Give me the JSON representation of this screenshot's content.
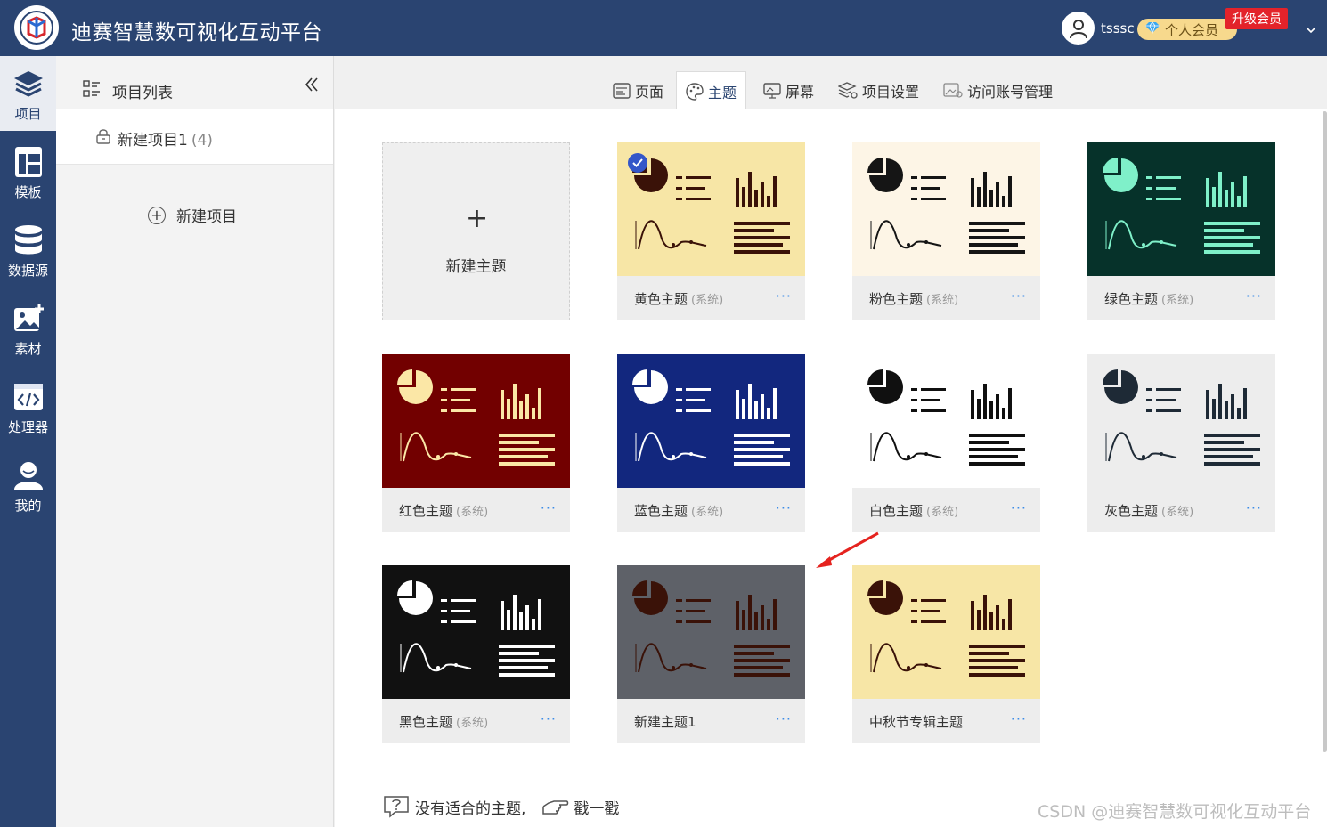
{
  "header": {
    "app_title": "迪赛智慧数可视化互动平台",
    "username": "tsssc",
    "member_label": "个人会员",
    "upgrade_label": "升级会员"
  },
  "nav": [
    {
      "label": "项目",
      "icon": "layers-icon"
    },
    {
      "label": "模板",
      "icon": "template-icon"
    },
    {
      "label": "数据源",
      "icon": "database-icon"
    },
    {
      "label": "素材",
      "icon": "image-add-icon"
    },
    {
      "label": "处理器",
      "icon": "code-icon"
    },
    {
      "label": "我的",
      "icon": "user-icon"
    }
  ],
  "projects": {
    "title": "项目列表",
    "item_name": "新建项目1",
    "item_count": "(4)",
    "new_label": "新建项目"
  },
  "tabs": [
    "页面",
    "主题",
    "屏幕",
    "项目设置",
    "访问账号管理"
  ],
  "new_theme_label": "新建主题",
  "themes": [
    {
      "name": "黄色主题",
      "tag": "(系统)",
      "bg": "#f7e6a6",
      "fg": "#3a1208",
      "selected": true
    },
    {
      "name": "粉色主题",
      "tag": "(系统)",
      "bg": "#fdf5e6",
      "fg": "#151515"
    },
    {
      "name": "绿色主题",
      "tag": "(系统)",
      "bg": "#06322a",
      "fg": "#7ff0c9"
    },
    {
      "name": "红色主题",
      "tag": "(系统)",
      "bg": "#720000",
      "fg": "#fbe7a6"
    },
    {
      "name": "蓝色主题",
      "tag": "(系统)",
      "bg": "#12277e",
      "fg": "#ffffff"
    },
    {
      "name": "白色主题",
      "tag": "(系统)",
      "bg": "#ffffff",
      "fg": "#101010"
    },
    {
      "name": "灰色主题",
      "tag": "(系统)",
      "bg": "#ededed",
      "fg": "#1e2a36"
    },
    {
      "name": "黑色主题",
      "tag": "(系统)",
      "bg": "#111111",
      "fg": "#ffffff"
    },
    {
      "name": "新建主题1",
      "tag": "",
      "bg": "#5e6168",
      "fg": "#3a1208"
    },
    {
      "name": "中秋节专辑主题",
      "tag": "",
      "bg": "#f7e6a6",
      "fg": "#3a1208"
    }
  ],
  "more_label": "···",
  "footer": {
    "help_text": "没有适合的主题,",
    "poke_label": "戳一戳"
  },
  "watermark": "CSDN @迪赛智慧数可视化互动平台"
}
